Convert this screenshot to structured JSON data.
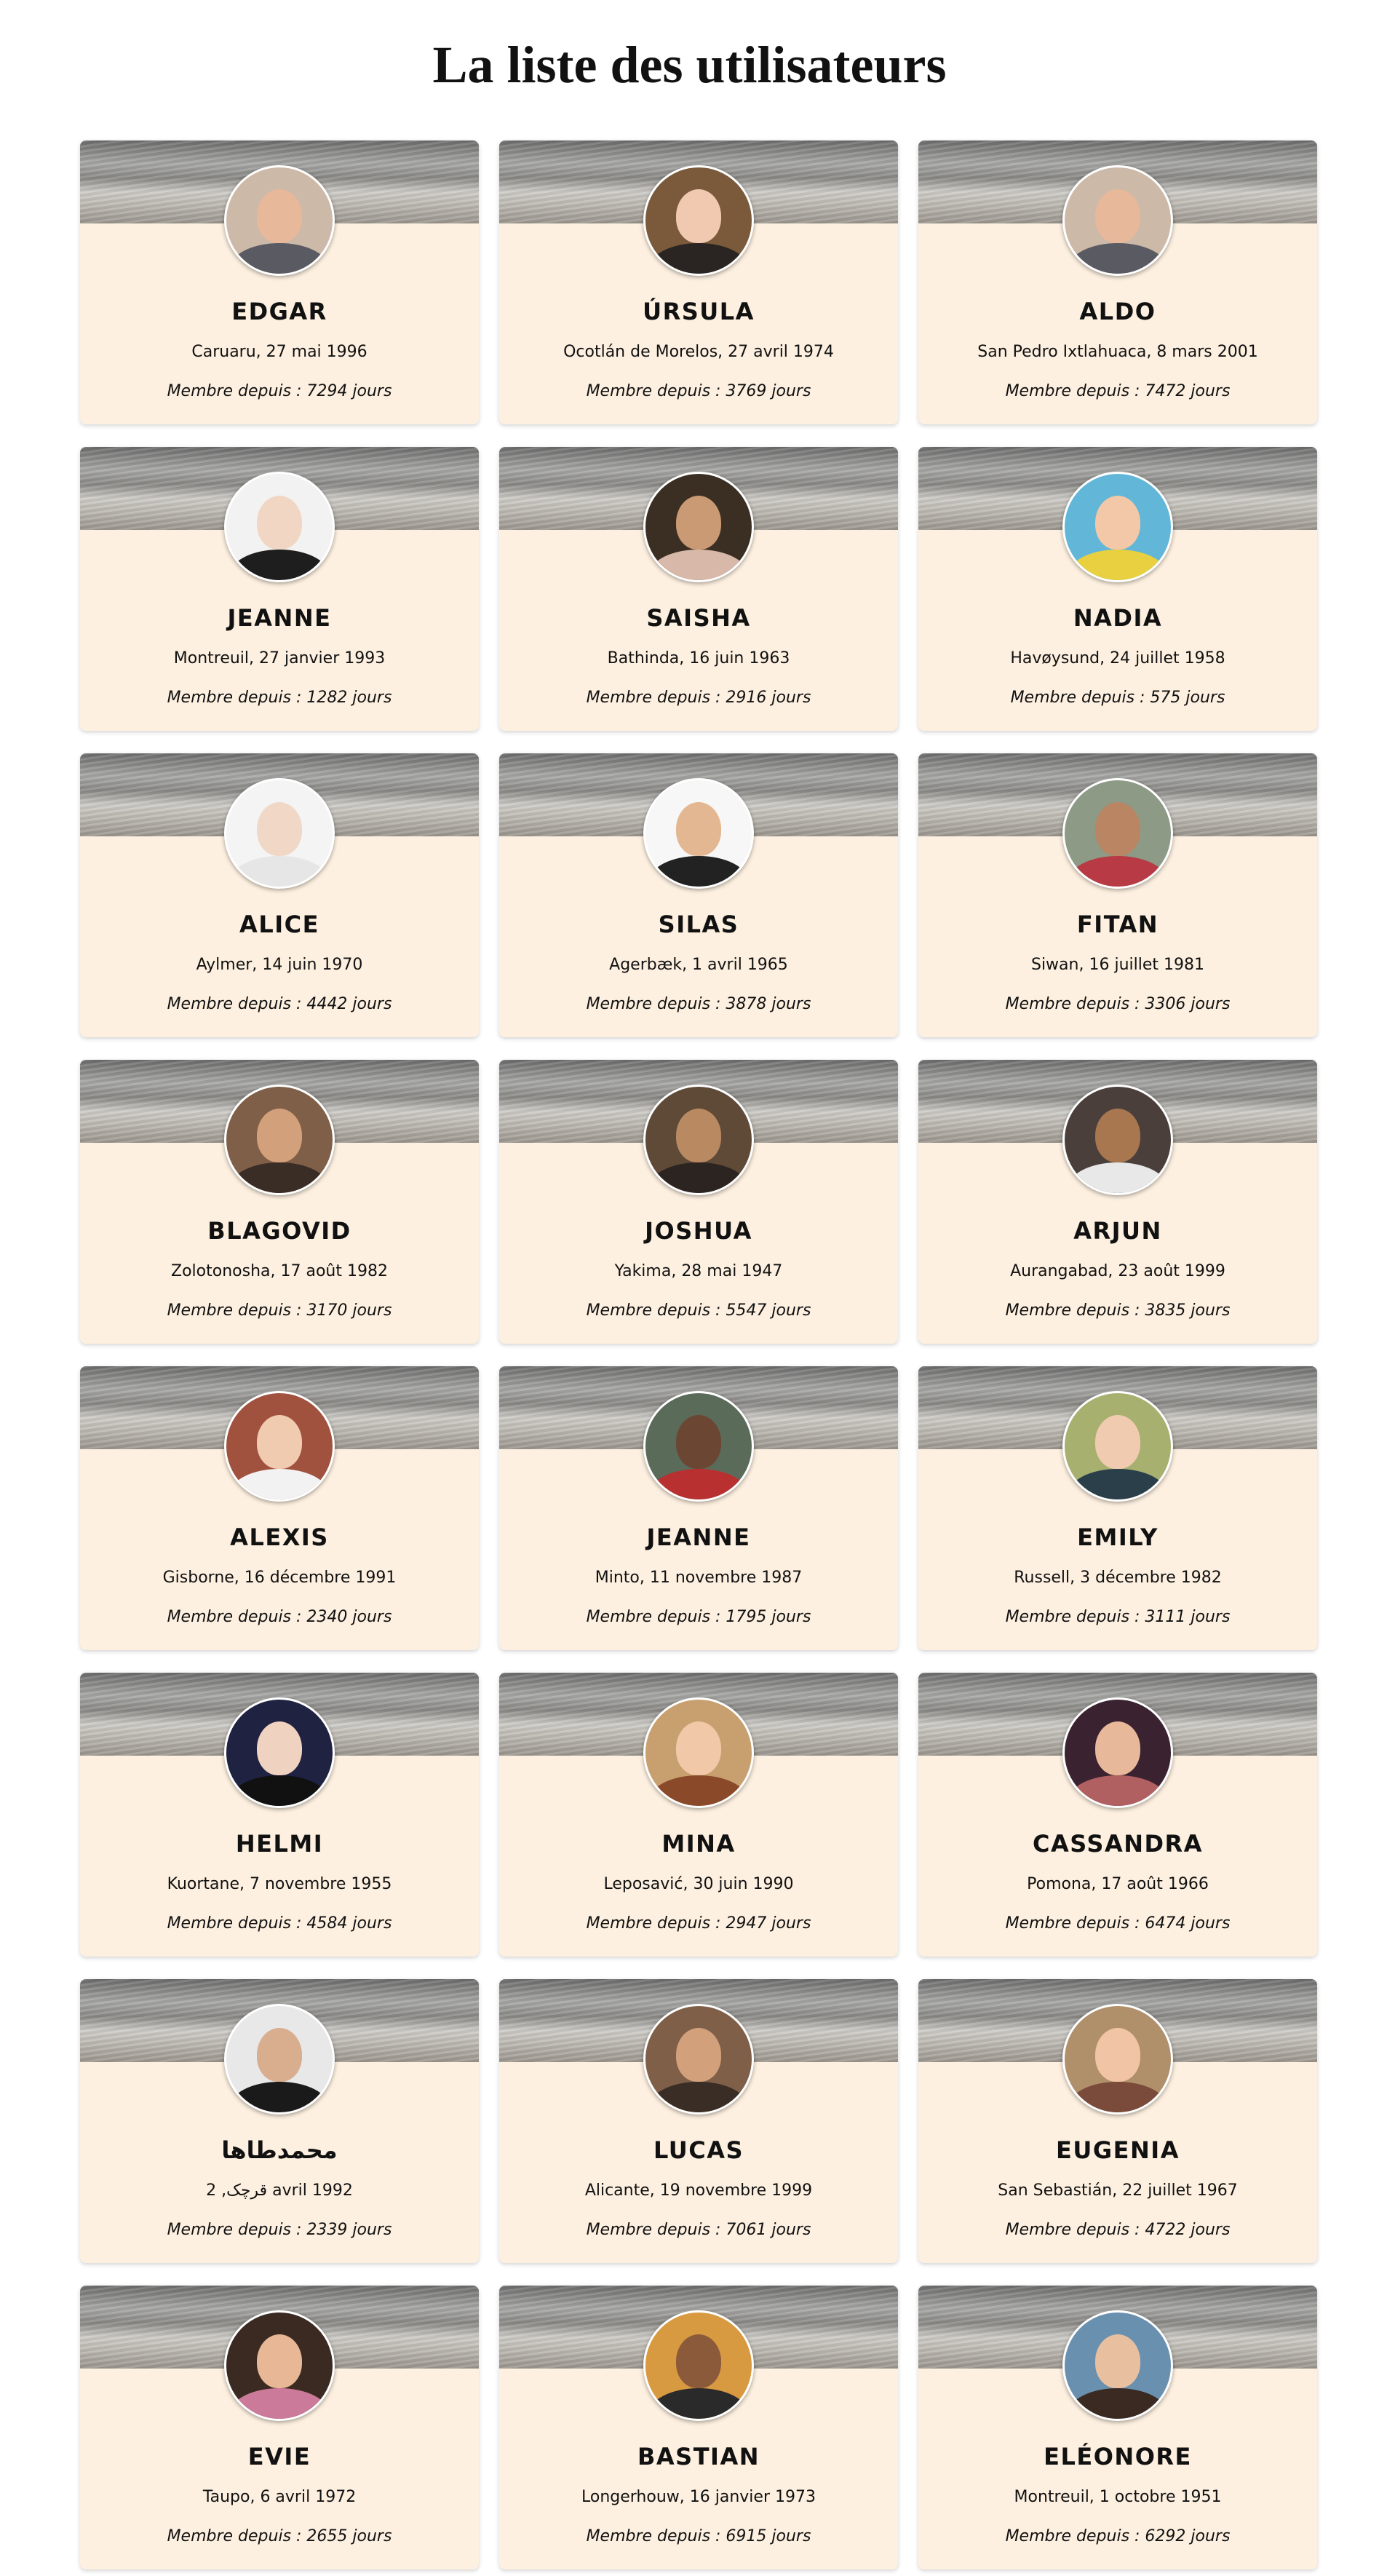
{
  "page": {
    "title": "La liste des utilisateurs"
  },
  "users": [
    {
      "name": "EDGAR",
      "place": "Caruaru, 27 mai 1996",
      "since": "Membre depuis : 7294 jours",
      "bg": "#cdb9a8",
      "skin": "#e8b89a",
      "cloth": "#5a5a62"
    },
    {
      "name": "ÚRSULA",
      "place": "Ocotlán de Morelos, 27 avril 1974",
      "since": "Membre depuis : 3769 jours",
      "bg": "#7a5a3a",
      "skin": "#f0c9b0",
      "cloth": "#2a2522"
    },
    {
      "name": "ALDO",
      "place": "San Pedro Ixtlahuaca, 8 mars 2001",
      "since": "Membre depuis : 7472 jours",
      "bg": "#cdb9a8",
      "skin": "#e8b89a",
      "cloth": "#5a5a62"
    },
    {
      "name": "JEANNE",
      "place": "Montreuil, 27 janvier 1993",
      "since": "Membre depuis : 1282 jours",
      "bg": "#f2f2f2",
      "skin": "#f1d6c3",
      "cloth": "#1e1e1e"
    },
    {
      "name": "SAISHA",
      "place": "Bathinda, 16 juin 1963",
      "since": "Membre depuis : 2916 jours",
      "bg": "#3b2f24",
      "skin": "#c99a73",
      "cloth": "#d8b8a8"
    },
    {
      "name": "NADIA",
      "place": "Havøysund, 24 juillet 1958",
      "since": "Membre depuis : 575 jours",
      "bg": "#62b6d8",
      "skin": "#f2c8a8",
      "cloth": "#e8d040"
    },
    {
      "name": "ALICE",
      "place": "Aylmer, 14 juin 1970",
      "since": "Membre depuis : 4442 jours",
      "bg": "#f4f4f4",
      "skin": "#f1d8c6",
      "cloth": "#e6e6e6"
    },
    {
      "name": "SILAS",
      "place": "Agerbæk, 1 avril 1965",
      "since": "Membre depuis : 3878 jours",
      "bg": "#f7f7f7",
      "skin": "#e3b791",
      "cloth": "#222222"
    },
    {
      "name": "FITAN",
      "place": "Siwan, 16 juillet 1981",
      "since": "Membre depuis : 3306 jours",
      "bg": "#8c9a86",
      "skin": "#b98563",
      "cloth": "#b83a44"
    },
    {
      "name": "BLAGOVID",
      "place": "Zolotonosha, 17 août 1982",
      "since": "Membre depuis : 3170 jours",
      "bg": "#7f5f48",
      "skin": "#d3a07c",
      "cloth": "#3a2d26"
    },
    {
      "name": "JOSHUA",
      "place": "Yakima, 28 mai 1947",
      "since": "Membre depuis : 5547 jours",
      "bg": "#5f4a38",
      "skin": "#b98962",
      "cloth": "#2c2420"
    },
    {
      "name": "ARJUN",
      "place": "Aurangabad, 23 août 1999",
      "since": "Membre depuis : 3835 jours",
      "bg": "#4a3f3a",
      "skin": "#a8764f",
      "cloth": "#e8e8e8"
    },
    {
      "name": "ALEXIS",
      "place": "Gisborne, 16 décembre 1991",
      "since": "Membre depuis : 2340 jours",
      "bg": "#a0523e",
      "skin": "#f1cbb0",
      "cloth": "#f2f2f2"
    },
    {
      "name": "JEANNE",
      "place": "Minto, 11 novembre 1987",
      "since": "Membre depuis : 1795 jours",
      "bg": "#5a6b5a",
      "skin": "#6b4632",
      "cloth": "#b83030"
    },
    {
      "name": "EMILY",
      "place": "Russell, 3 décembre 1982",
      "since": "Membre depuis : 3111 jours",
      "bg": "#a8b070",
      "skin": "#f1cbb0",
      "cloth": "#2a3f4a"
    },
    {
      "name": "HELMI",
      "place": "Kuortane, 7 novembre 1955",
      "since": "Membre depuis : 4584 jours",
      "bg": "#1f2240",
      "skin": "#f0d2c0",
      "cloth": "#111111"
    },
    {
      "name": "MINA",
      "place": "Leposavić, 30 juin 1990",
      "since": "Membre depuis : 2947 jours",
      "bg": "#c8a070",
      "skin": "#f1c8a8",
      "cloth": "#8a4a2a"
    },
    {
      "name": "CASSANDRA",
      "place": "Pomona, 17 août 1966",
      "since": "Membre depuis : 6474 jours",
      "bg": "#3a2230",
      "skin": "#e8b89a",
      "cloth": "#b06060"
    },
    {
      "name": "محمدطاها",
      "place": "قرچک, 2 avril 1992",
      "since": "Membre depuis : 2339 jours",
      "bg": "#e8e8e8",
      "skin": "#d8ae8e",
      "cloth": "#1a1a1a"
    },
    {
      "name": "LUCAS",
      "place": "Alicante, 19 novembre 1999",
      "since": "Membre depuis : 7061 jours",
      "bg": "#7f5f48",
      "skin": "#d3a07c",
      "cloth": "#3a2d26"
    },
    {
      "name": "EUGENIA",
      "place": "San Sebastián, 22 juillet 1967",
      "since": "Membre depuis : 4722 jours",
      "bg": "#b0906a",
      "skin": "#f0c4a4",
      "cloth": "#7a4a3a"
    },
    {
      "name": "EVIE",
      "place": "Taupo, 6 avril 1972",
      "since": "Membre depuis : 2655 jours",
      "bg": "#3a2a22",
      "skin": "#e8b896",
      "cloth": "#cc7a9a"
    },
    {
      "name": "BASTIAN",
      "place": "Longerhouw, 16 janvier 1973",
      "since": "Membre depuis : 6915 jours",
      "bg": "#d89a40",
      "skin": "#8a5a3a",
      "cloth": "#2a2a2a"
    },
    {
      "name": "ELÉONORE",
      "place": "Montreuil, 1 octobre 1951",
      "since": "Membre depuis : 6292 jours",
      "bg": "#6a90b0",
      "skin": "#e8c0a0",
      "cloth": "#3a2a22"
    }
  ]
}
